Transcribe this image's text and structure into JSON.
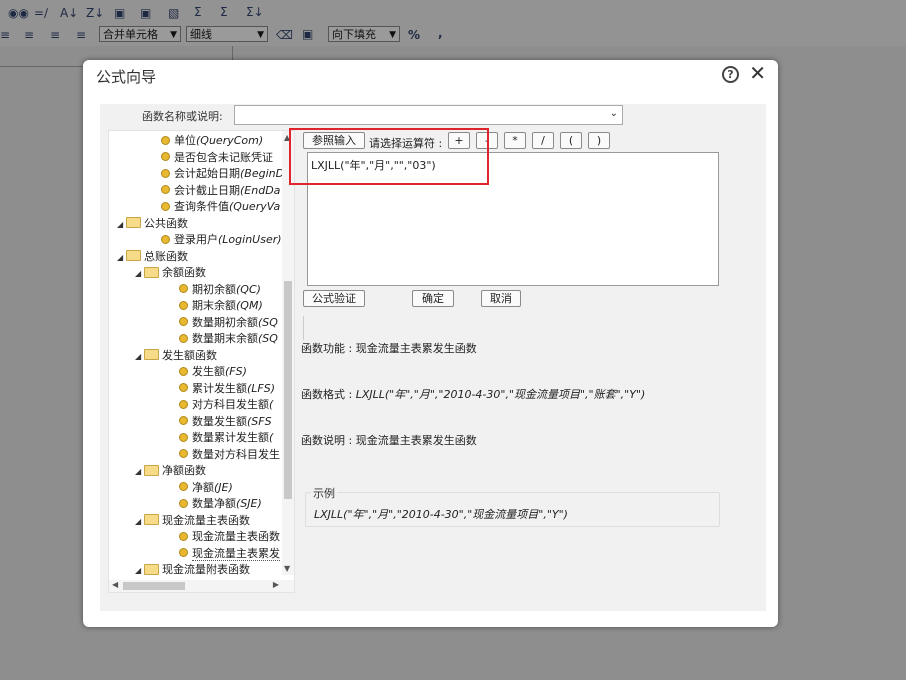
{
  "background": {
    "toolbar_icons": [
      "binoculars-icon",
      "find-replace-icon",
      "sort-asc-icon",
      "sort-desc-icon",
      "paste-icon",
      "paste-special-icon",
      "document-icon",
      "sum-icon",
      "sum-col-icon",
      "sum-row-icon"
    ],
    "merge_cells": "合并单元格",
    "line_style": "细线",
    "fill_down": "向下填充",
    "percent": "%",
    "comma": ","
  },
  "dialog": {
    "title": "公式向导",
    "function_label": "函数名称或说明:",
    "function_value": "",
    "tree": [
      {
        "label": "单位",
        "italic": "(QueryCom)",
        "level": 3,
        "type": "leaf"
      },
      {
        "label": "是否包含未记账凭证",
        "italic": "",
        "level": 3,
        "type": "leaf"
      },
      {
        "label": "会计起始日期",
        "italic": "(BeginD",
        "level": 3,
        "type": "leaf"
      },
      {
        "label": "会计截止日期",
        "italic": "(EndDa",
        "level": 3,
        "type": "leaf"
      },
      {
        "label": "查询条件值",
        "italic": "(QueryVa",
        "level": 3,
        "type": "leaf"
      },
      {
        "label": "公共函数",
        "italic": "",
        "level": 1,
        "type": "folder"
      },
      {
        "label": "登录用户",
        "italic": "(LoginUser)",
        "level": 3,
        "type": "leaf"
      },
      {
        "label": "总账函数",
        "italic": "",
        "level": 1,
        "type": "folder"
      },
      {
        "label": "余额函数",
        "italic": "",
        "level": 2,
        "type": "folder"
      },
      {
        "label": "期初余额",
        "italic": "(QC)",
        "level": 4,
        "type": "leaf"
      },
      {
        "label": "期末余额",
        "italic": "(QM)",
        "level": 4,
        "type": "leaf"
      },
      {
        "label": "数量期初余额",
        "italic": "(SQ",
        "level": 4,
        "type": "leaf"
      },
      {
        "label": "数量期末余额",
        "italic": "(SQ",
        "level": 4,
        "type": "leaf"
      },
      {
        "label": "发生额函数",
        "italic": "",
        "level": 2,
        "type": "folder"
      },
      {
        "label": "发生额",
        "italic": "(FS)",
        "level": 4,
        "type": "leaf"
      },
      {
        "label": "累计发生额",
        "italic": "(LFS)",
        "level": 4,
        "type": "leaf"
      },
      {
        "label": "对方科目发生额",
        "italic": "(",
        "level": 4,
        "type": "leaf"
      },
      {
        "label": "数量发生额",
        "italic": "(SFS",
        "level": 4,
        "type": "leaf"
      },
      {
        "label": "数量累计发生额",
        "italic": "(",
        "level": 4,
        "type": "leaf"
      },
      {
        "label": "数量对方科目发生",
        "italic": "",
        "level": 4,
        "type": "leaf"
      },
      {
        "label": "净额函数",
        "italic": "",
        "level": 2,
        "type": "folder"
      },
      {
        "label": "净额",
        "italic": "(JE)",
        "level": 4,
        "type": "leaf"
      },
      {
        "label": "数量净额",
        "italic": "(SJE)",
        "level": 4,
        "type": "leaf"
      },
      {
        "label": "现金流量主表函数",
        "italic": "",
        "level": 2,
        "type": "folder"
      },
      {
        "label": "现金流量主表函数",
        "italic": "",
        "level": 4,
        "type": "leaf"
      },
      {
        "label": "现金流量主表累发",
        "italic": "",
        "level": 4,
        "type": "leaf",
        "selected": true
      },
      {
        "label": "现金流量附表函数",
        "italic": "",
        "level": 2,
        "type": "folder"
      }
    ],
    "ref_input_button": "参照输入",
    "operator_label": "请选择运算符 :",
    "operators": [
      "+",
      "-",
      "*",
      "/",
      "(",
      ")"
    ],
    "formula": "LXJLL(\"年\",\"月\",\"\",\"03\")",
    "validate_button": "公式验证",
    "ok_button": "确定",
    "cancel_button": "取消",
    "function_desc_label": "函数功能 :",
    "function_desc": "现金流量主表累发生函数",
    "format_label": "函数格式 :",
    "format_value": "LXJLL(\"年\",\"月\",\"2010-4-30\",\"现金流量项目\",\"账套\",\"Y\")",
    "explain_label": "函数说明 :",
    "explain_value": "现金流量主表累发生函数",
    "example_legend": "示例",
    "example_text": "LXJLL(\"年\",\"月\",\"2010-4-30\",\"现金流量项目\",\"Y\")"
  }
}
